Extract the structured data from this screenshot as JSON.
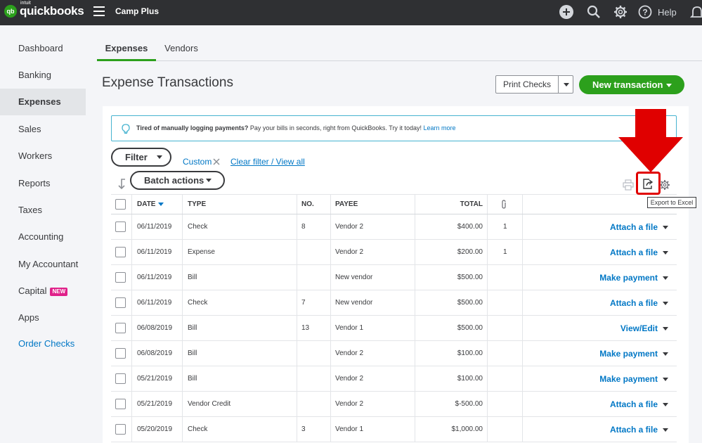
{
  "topbar": {
    "logo_intuit": "intuit",
    "logo_word": "quickbooks",
    "logo_badge": "qb",
    "company_name": "Camp Plus",
    "help_label": "Help"
  },
  "sidebar": {
    "items": [
      {
        "label": "Dashboard"
      },
      {
        "label": "Banking"
      },
      {
        "label": "Expenses"
      },
      {
        "label": "Sales"
      },
      {
        "label": "Workers"
      },
      {
        "label": "Reports"
      },
      {
        "label": "Taxes"
      },
      {
        "label": "Accounting"
      },
      {
        "label": "My Accountant"
      },
      {
        "label": "Capital",
        "badge": "NEW"
      },
      {
        "label": "Apps"
      },
      {
        "label": "Order Checks"
      }
    ]
  },
  "tabs": [
    "Expenses",
    "Vendors"
  ],
  "page_title": "Expense Transactions",
  "buttons": {
    "print_checks": "Print Checks",
    "new_transaction": "New transaction",
    "filter": "Filter",
    "batch_actions": "Batch actions"
  },
  "banner": {
    "bold": "Tired of manually logging payments?",
    "text": " Pay your bills in seconds, right from QuickBooks. Try it today! ",
    "link": "Learn more"
  },
  "filter_bar": {
    "custom": "Custom",
    "clear": "Clear filter / View all"
  },
  "tooltip": "Export to Excel",
  "table": {
    "headers": {
      "date": "DATE",
      "type": "TYPE",
      "no": "NO.",
      "payee": "PAYEE",
      "total": "TOTAL"
    },
    "rows": [
      {
        "date": "06/11/2019",
        "type": "Check",
        "no": "8",
        "payee": "Vendor 2",
        "total": "$400.00",
        "attach": "1",
        "action": "Attach a file"
      },
      {
        "date": "06/11/2019",
        "type": "Expense",
        "no": "",
        "payee": "Vendor 2",
        "total": "$200.00",
        "attach": "1",
        "action": "Attach a file"
      },
      {
        "date": "06/11/2019",
        "type": "Bill",
        "no": "",
        "payee": "New vendor",
        "total": "$500.00",
        "attach": "",
        "action": "Make payment"
      },
      {
        "date": "06/11/2019",
        "type": "Check",
        "no": "7",
        "payee": "New vendor",
        "total": "$500.00",
        "attach": "",
        "action": "Attach a file"
      },
      {
        "date": "06/08/2019",
        "type": "Bill",
        "no": "13",
        "payee": "Vendor 1",
        "total": "$500.00",
        "attach": "",
        "action": "View/Edit"
      },
      {
        "date": "06/08/2019",
        "type": "Bill",
        "no": "",
        "payee": "Vendor 2",
        "total": "$100.00",
        "attach": "",
        "action": "Make payment"
      },
      {
        "date": "05/21/2019",
        "type": "Bill",
        "no": "",
        "payee": "Vendor 2",
        "total": "$100.00",
        "attach": "",
        "action": "Make payment"
      },
      {
        "date": "05/21/2019",
        "type": "Vendor Credit",
        "no": "",
        "payee": "Vendor 2",
        "total": "$-500.00",
        "attach": "",
        "action": "Attach a file"
      },
      {
        "date": "05/20/2019",
        "type": "Check",
        "no": "3",
        "payee": "Vendor 1",
        "total": "$1,000.00",
        "attach": "",
        "action": "Attach a file"
      }
    ]
  },
  "icons": {
    "add": "plus-circle-icon",
    "search": "search-icon",
    "settings": "gear-icon",
    "help": "help-icon",
    "notifications": "bell-icon",
    "print": "printer-icon",
    "export": "export-icon",
    "table_settings": "gear-icon",
    "attachment": "paperclip-icon"
  },
  "colors": {
    "brand_green": "#2ca01c",
    "link_blue": "#0077c5",
    "topbar": "#2f3033",
    "annotation_red": "#e00000"
  }
}
